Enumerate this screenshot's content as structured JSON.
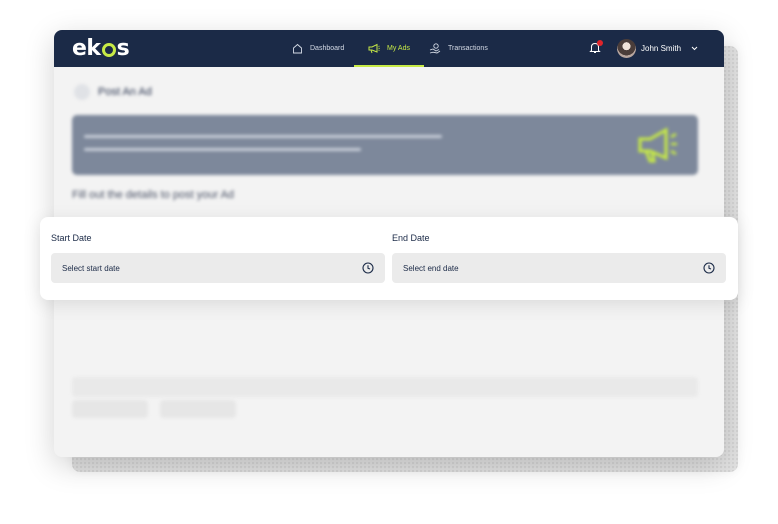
{
  "brand": {
    "logo_text_left": "ek",
    "logo_text_right": "s",
    "accent": "#c7ea46",
    "nav_bg": "#1b2a47"
  },
  "nav": {
    "items": [
      {
        "label": "Dashboard",
        "icon": "home-icon",
        "active": false
      },
      {
        "label": "My Ads",
        "icon": "megaphone-icon",
        "active": true
      },
      {
        "label": "Transactions",
        "icon": "hand-coin-icon",
        "active": false
      }
    ],
    "notifications_icon": "bell-icon",
    "user_name": "John Smith"
  },
  "page": {
    "back_title": "Post An Ad",
    "section_title": "Fill out the details to post your Ad"
  },
  "date_card": {
    "start": {
      "label": "Start Date",
      "placeholder": "Select start date",
      "icon": "clock-icon"
    },
    "end": {
      "label": "End Date",
      "placeholder": "Select end date",
      "icon": "clock-icon"
    }
  }
}
